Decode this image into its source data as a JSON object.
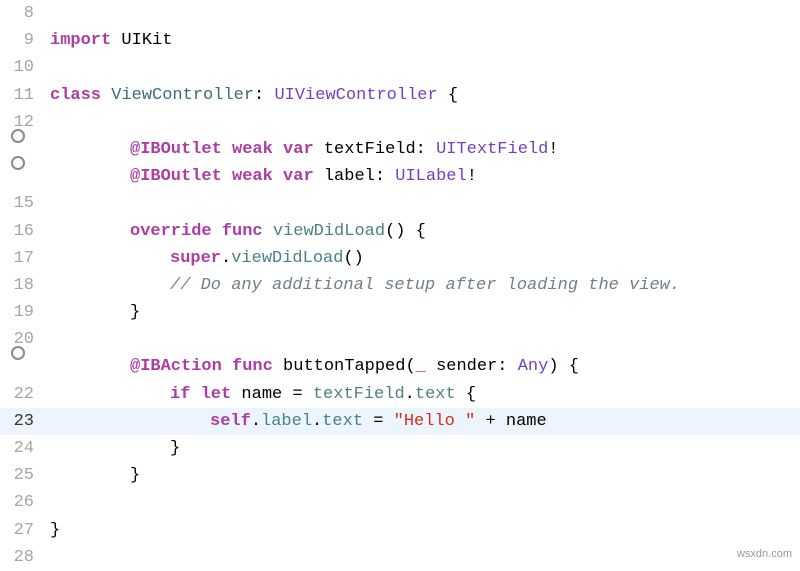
{
  "lines": [
    {
      "num": "8",
      "bp": false,
      "hl": false,
      "tokens": []
    },
    {
      "num": "9",
      "bp": false,
      "hl": false,
      "tokens": [
        {
          "cls": "keyword",
          "t": "import"
        },
        {
          "cls": "plain",
          "t": " UIKit"
        }
      ]
    },
    {
      "num": "10",
      "bp": false,
      "hl": false,
      "tokens": []
    },
    {
      "num": "11",
      "bp": false,
      "hl": false,
      "tokens": [
        {
          "cls": "keyword",
          "t": "class"
        },
        {
          "cls": "plain",
          "t": " "
        },
        {
          "cls": "identifier",
          "t": "ViewController"
        },
        {
          "cls": "plain",
          "t": ": "
        },
        {
          "cls": "type",
          "t": "UIViewController"
        },
        {
          "cls": "plain",
          "t": " {"
        }
      ]
    },
    {
      "num": "12",
      "bp": false,
      "hl": false,
      "tokens": []
    },
    {
      "num": "",
      "bp": true,
      "hl": false,
      "indent": 2,
      "tokens": [
        {
          "cls": "attr",
          "t": "@IBOutlet"
        },
        {
          "cls": "plain",
          "t": " "
        },
        {
          "cls": "keyword",
          "t": "weak"
        },
        {
          "cls": "plain",
          "t": " "
        },
        {
          "cls": "keyword",
          "t": "var"
        },
        {
          "cls": "plain",
          "t": " textField: "
        },
        {
          "cls": "type",
          "t": "UITextField"
        },
        {
          "cls": "plain",
          "t": "!"
        }
      ]
    },
    {
      "num": "",
      "bp": true,
      "hl": false,
      "indent": 2,
      "tokens": [
        {
          "cls": "attr",
          "t": "@IBOutlet"
        },
        {
          "cls": "plain",
          "t": " "
        },
        {
          "cls": "keyword",
          "t": "weak"
        },
        {
          "cls": "plain",
          "t": " "
        },
        {
          "cls": "keyword",
          "t": "var"
        },
        {
          "cls": "plain",
          "t": " label: "
        },
        {
          "cls": "type",
          "t": "UILabel"
        },
        {
          "cls": "plain",
          "t": "!"
        }
      ]
    },
    {
      "num": "15",
      "bp": false,
      "hl": false,
      "tokens": []
    },
    {
      "num": "16",
      "bp": false,
      "hl": false,
      "indent": 2,
      "tokens": [
        {
          "cls": "keyword",
          "t": "override"
        },
        {
          "cls": "plain",
          "t": " "
        },
        {
          "cls": "keyword",
          "t": "func"
        },
        {
          "cls": "plain",
          "t": " "
        },
        {
          "cls": "method",
          "t": "viewDidLoad"
        },
        {
          "cls": "plain",
          "t": "() {"
        }
      ]
    },
    {
      "num": "17",
      "bp": false,
      "hl": false,
      "indent": 3,
      "tokens": [
        {
          "cls": "keyword",
          "t": "super"
        },
        {
          "cls": "plain",
          "t": "."
        },
        {
          "cls": "method",
          "t": "viewDidLoad"
        },
        {
          "cls": "plain",
          "t": "()"
        }
      ]
    },
    {
      "num": "18",
      "bp": false,
      "hl": false,
      "indent": 3,
      "tokens": [
        {
          "cls": "comment",
          "t": "// Do any additional setup after loading the view."
        }
      ]
    },
    {
      "num": "19",
      "bp": false,
      "hl": false,
      "indent": 2,
      "tokens": [
        {
          "cls": "plain",
          "t": "}"
        }
      ]
    },
    {
      "num": "20",
      "bp": false,
      "hl": false,
      "tokens": []
    },
    {
      "num": "",
      "bp": true,
      "hl": false,
      "indent": 2,
      "tokens": [
        {
          "cls": "attr",
          "t": "@IBAction"
        },
        {
          "cls": "plain",
          "t": " "
        },
        {
          "cls": "keyword",
          "t": "func"
        },
        {
          "cls": "plain",
          "t": " buttonTapped("
        },
        {
          "cls": "keyword",
          "t": "_"
        },
        {
          "cls": "plain",
          "t": " sender: "
        },
        {
          "cls": "type",
          "t": "Any"
        },
        {
          "cls": "plain",
          "t": ") {"
        }
      ]
    },
    {
      "num": "22",
      "bp": false,
      "hl": false,
      "indent": 3,
      "tokens": [
        {
          "cls": "keyword",
          "t": "if"
        },
        {
          "cls": "plain",
          "t": " "
        },
        {
          "cls": "keyword",
          "t": "let"
        },
        {
          "cls": "plain",
          "t": " name = "
        },
        {
          "cls": "method",
          "t": "textField"
        },
        {
          "cls": "plain",
          "t": "."
        },
        {
          "cls": "method",
          "t": "text"
        },
        {
          "cls": "plain",
          "t": " {"
        }
      ]
    },
    {
      "num": "23",
      "bp": false,
      "hl": true,
      "indent": 4,
      "tokens": [
        {
          "cls": "keyword",
          "t": "self"
        },
        {
          "cls": "plain",
          "t": "."
        },
        {
          "cls": "method",
          "t": "label"
        },
        {
          "cls": "plain",
          "t": "."
        },
        {
          "cls": "method",
          "t": "text"
        },
        {
          "cls": "plain",
          "t": " = "
        },
        {
          "cls": "string",
          "t": "\"Hello \""
        },
        {
          "cls": "plain",
          "t": " + name"
        }
      ]
    },
    {
      "num": "24",
      "bp": false,
      "hl": false,
      "indent": 3,
      "tokens": [
        {
          "cls": "plain",
          "t": "}"
        }
      ]
    },
    {
      "num": "25",
      "bp": false,
      "hl": false,
      "indent": 2,
      "tokens": [
        {
          "cls": "plain",
          "t": "}"
        }
      ]
    },
    {
      "num": "26",
      "bp": false,
      "hl": false,
      "tokens": []
    },
    {
      "num": "27",
      "bp": false,
      "hl": false,
      "tokens": [
        {
          "cls": "plain",
          "t": "}"
        }
      ]
    },
    {
      "num": "28",
      "bp": false,
      "hl": false,
      "tokens": []
    }
  ],
  "watermark": "wsxdn.com"
}
